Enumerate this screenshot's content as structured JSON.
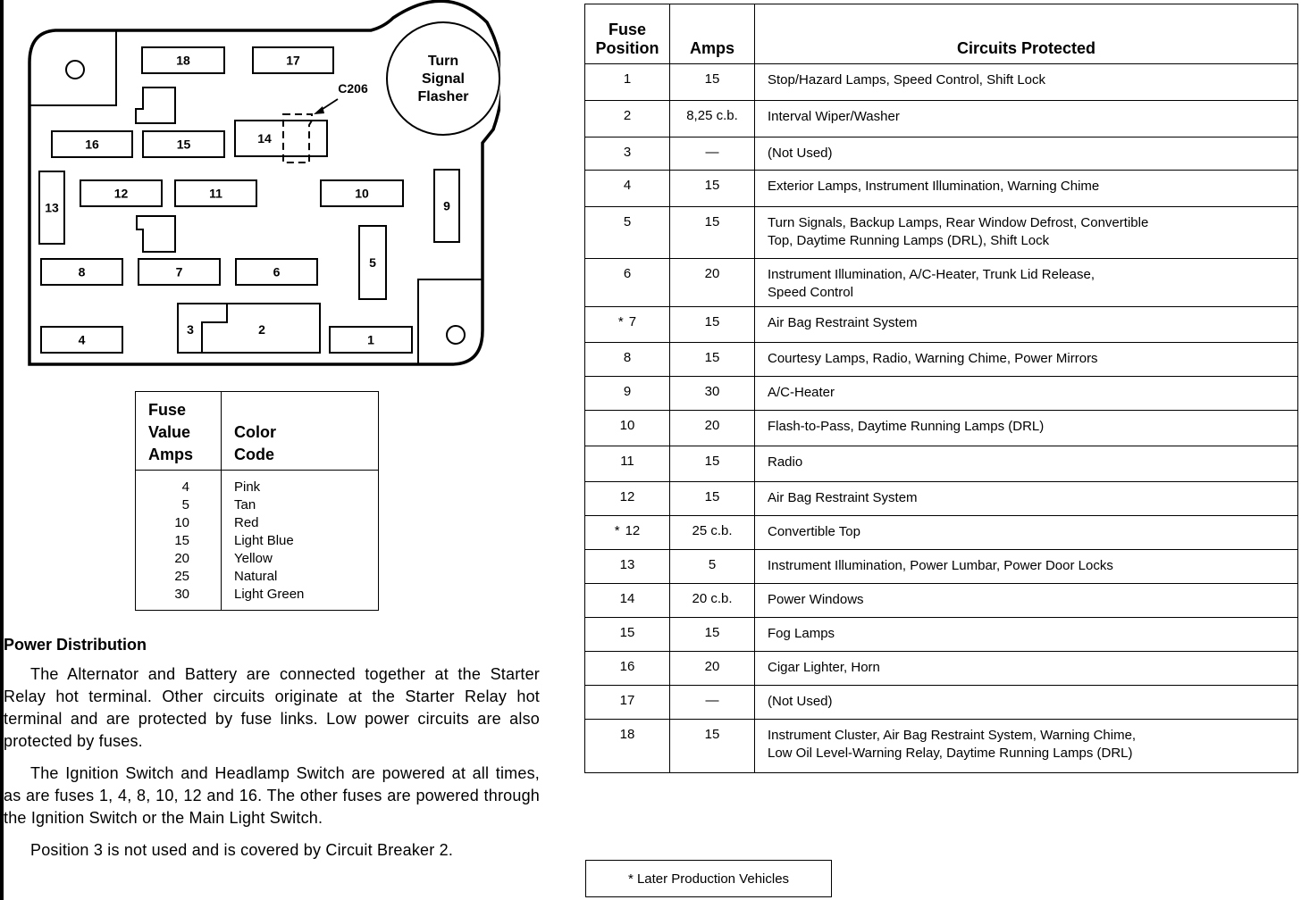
{
  "diagram": {
    "fuse_labels": [
      "1",
      "2",
      "3",
      "4",
      "5",
      "6",
      "7",
      "8",
      "9",
      "10",
      "11",
      "12",
      "13",
      "14",
      "15",
      "16",
      "17",
      "18"
    ],
    "flasher_label_lines": [
      "Turn",
      "Signal",
      "Flasher"
    ],
    "connector_label": "C206"
  },
  "color_code_table": {
    "headers": {
      "amps_lines": [
        "Fuse",
        "Value",
        "Amps"
      ],
      "code_lines": [
        "Color",
        "Code"
      ]
    },
    "rows": [
      {
        "amps": "4",
        "color": "Pink"
      },
      {
        "amps": "5",
        "color": "Tan"
      },
      {
        "amps": "10",
        "color": "Red"
      },
      {
        "amps": "15",
        "color": "Light Blue"
      },
      {
        "amps": "20",
        "color": "Yellow"
      },
      {
        "amps": "25",
        "color": "Natural"
      },
      {
        "amps": "30",
        "color": "Light Green"
      }
    ]
  },
  "power_distribution": {
    "title": "Power Distribution",
    "paragraphs": [
      "The Alternator and Battery are connected together at the Starter Relay hot terminal. Other circuits originate at the Starter Relay hot terminal and are protected by fuse links. Low power circuits are also protected by fuses.",
      "The Ignition Switch and Headlamp Switch are powered at all times, as are fuses 1, 4, 8, 10, 12 and 16. The other fuses are powered through the Ignition Switch or the Main Light Switch.",
      "Position 3 is not used and is covered by Circuit Breaker 2."
    ]
  },
  "fuse_table": {
    "headers": {
      "position_lines": [
        "Fuse",
        "Position"
      ],
      "amps": "Amps",
      "circuits": "Circuits Protected"
    },
    "rows": [
      {
        "star": "",
        "position": "1",
        "amps": "15",
        "circuits": [
          "Stop/Hazard Lamps, Speed Control, Shift Lock"
        ]
      },
      {
        "star": "",
        "position": "2",
        "amps": "8,25 c.b.",
        "circuits": [
          "Interval Wiper/Washer"
        ]
      },
      {
        "star": "",
        "position": "3",
        "amps": "—",
        "circuits": [
          "(Not Used)"
        ]
      },
      {
        "star": "",
        "position": "4",
        "amps": "15",
        "circuits": [
          "Exterior Lamps, Instrument Illumination, Warning Chime"
        ]
      },
      {
        "star": "",
        "position": "5",
        "amps": "15",
        "circuits": [
          "Turn Signals, Backup Lamps, Rear Window Defrost, Convertible",
          "Top, Daytime Running Lamps (DRL), Shift Lock"
        ]
      },
      {
        "star": "",
        "position": "6",
        "amps": "20",
        "circuits": [
          "Instrument Illumination, A/C-Heater, Trunk Lid Release,",
          "Speed Control"
        ]
      },
      {
        "star": "*",
        "position": "7",
        "amps": "15",
        "circuits": [
          "Air Bag Restraint System"
        ]
      },
      {
        "star": "",
        "position": "8",
        "amps": "15",
        "circuits": [
          "Courtesy Lamps, Radio, Warning Chime, Power Mirrors"
        ]
      },
      {
        "star": "",
        "position": "9",
        "amps": "30",
        "circuits": [
          "A/C-Heater"
        ]
      },
      {
        "star": "",
        "position": "10",
        "amps": "20",
        "circuits": [
          "Flash-to-Pass, Daytime Running Lamps (DRL)"
        ]
      },
      {
        "star": "",
        "position": "11",
        "amps": "15",
        "circuits": [
          "Radio"
        ]
      },
      {
        "star": "",
        "position": "12",
        "amps": "15",
        "circuits": [
          "Air Bag Restraint System"
        ]
      },
      {
        "star": "*",
        "position": "12",
        "amps": "25 c.b.",
        "circuits": [
          "Convertible Top"
        ]
      },
      {
        "star": "",
        "position": "13",
        "amps": "5",
        "circuits": [
          "Instrument Illumination, Power Lumbar, Power Door Locks"
        ]
      },
      {
        "star": "",
        "position": "14",
        "amps": "20 c.b.",
        "circuits": [
          "Power Windows"
        ]
      },
      {
        "star": "",
        "position": "15",
        "amps": "15",
        "circuits": [
          "Fog Lamps"
        ]
      },
      {
        "star": "",
        "position": "16",
        "amps": "20",
        "circuits": [
          "Cigar Lighter, Horn"
        ]
      },
      {
        "star": "",
        "position": "17",
        "amps": "—",
        "circuits": [
          "(Not Used)"
        ]
      },
      {
        "star": "",
        "position": "18",
        "amps": "15",
        "circuits": [
          "Instrument Cluster, Air Bag Restraint System, Warning Chime,",
          "Low Oil Level-Warning Relay, Daytime Running Lamps (DRL)"
        ]
      }
    ]
  },
  "footnote": "* Later Production Vehicles"
}
